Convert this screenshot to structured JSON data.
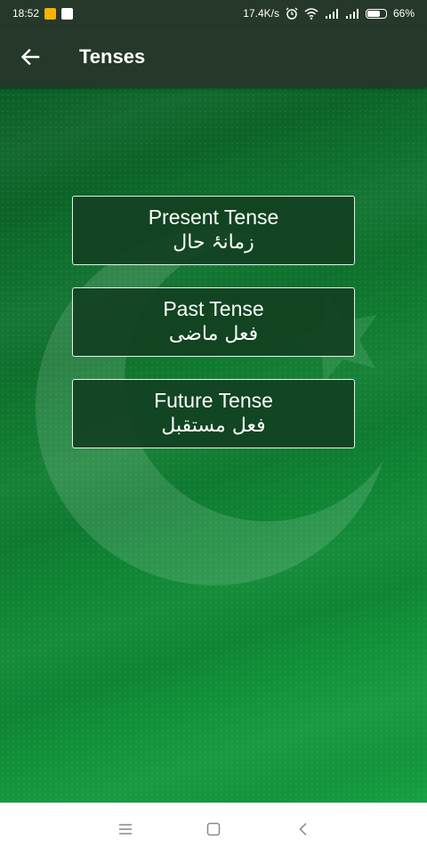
{
  "status_bar": {
    "time": "18:52",
    "network_speed": "17.4K/s",
    "battery_percent": "66%",
    "battery_level": 0.66,
    "icons": [
      "notification-o-icon",
      "notification-g-icon",
      "alarm-icon",
      "wifi-icon",
      "signal-icon",
      "signal-icon",
      "battery-icon"
    ]
  },
  "app_bar": {
    "title": "Tenses",
    "back_icon": "arrow-left-icon"
  },
  "tenses": [
    {
      "english": "Present Tense",
      "urdu": "زمانۂ حال"
    },
    {
      "english": "Past Tense",
      "urdu": "فعل ماضی"
    },
    {
      "english": "Future Tense",
      "urdu": "فعل مستقبل"
    }
  ],
  "nav_bar": {
    "icons": [
      "menu-icon",
      "home-square-icon",
      "back-chevron-icon"
    ]
  },
  "colors": {
    "app_bar": "#25382a",
    "background_green": "#0f8a36",
    "button_fill": "#124022",
    "button_border": "#e6efe8"
  }
}
